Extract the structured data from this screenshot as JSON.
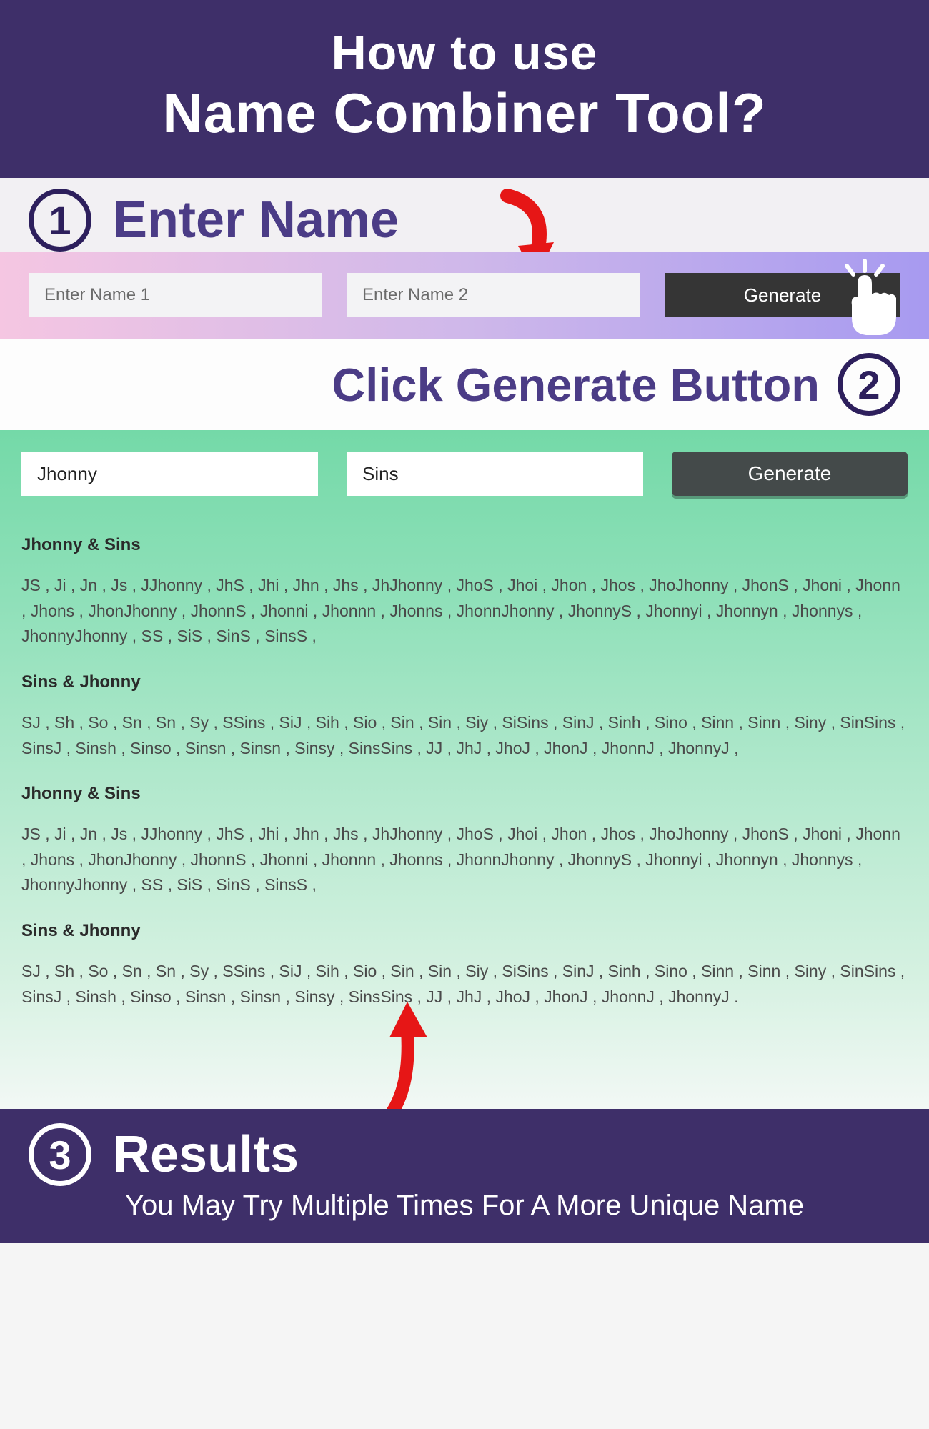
{
  "header": {
    "line1": "How to use",
    "line2": "Name Combiner Tool?"
  },
  "step1": {
    "num": "1",
    "label": "Enter Name",
    "input1_placeholder": "Enter Name 1",
    "input2_placeholder": "Enter Name 2",
    "button": "Generate"
  },
  "step2": {
    "num": "2",
    "label": "Click Generate Button"
  },
  "results": {
    "input1_value": "Jhonny",
    "input2_value": "Sins",
    "button": "Generate",
    "blocks": [
      {
        "heading": "Jhonny & Sins",
        "text": "JS , Ji , Jn , Js , JJhonny , JhS , Jhi , Jhn , Jhs , JhJhonny , JhoS , Jhoi , Jhon , Jhos , JhoJhonny , JhonS , Jhoni , Jhonn , Jhons , JhonJhonny , JhonnS , Jhonni , Jhonnn , Jhonns , JhonnJhonny , JhonnyS , Jhonnyi , Jhonnyn , Jhonnys , JhonnyJhonny , SS , SiS , SinS , SinsS ,"
      },
      {
        "heading": "Sins & Jhonny",
        "text": "SJ , Sh , So , Sn , Sn , Sy , SSins , SiJ , Sih , Sio , Sin , Sin , Siy , SiSins , SinJ , Sinh , Sino , Sinn , Sinn , Siny , SinSins , SinsJ , Sinsh , Sinso , Sinsn , Sinsn , Sinsy , SinsSins , JJ , JhJ , JhoJ , JhonJ , JhonnJ , JhonnyJ ,"
      },
      {
        "heading": "Jhonny & Sins",
        "text": "JS , Ji , Jn , Js , JJhonny , JhS , Jhi , Jhn , Jhs , JhJhonny , JhoS , Jhoi , Jhon , Jhos , JhoJhonny , JhonS , Jhoni , Jhonn , Jhons , JhonJhonny , JhonnS , Jhonni , Jhonnn , Jhonns , JhonnJhonny , JhonnyS , Jhonnyi , Jhonnyn , Jhonnys , JhonnyJhonny , SS , SiS , SinS , SinsS ,"
      },
      {
        "heading": "Sins & Jhonny",
        "text": "SJ , Sh , So , Sn , Sn , Sy , SSins , SiJ , Sih , Sio , Sin , Sin , Siy , SiSins , SinJ , Sinh , Sino , Sinn , Sinn , Siny , SinSins , SinsJ , Sinsh , Sinso , Sinsn , Sinsn , Sinsy , SinsSins , JJ , JhJ , JhoJ , JhonJ , JhonnJ , JhonnyJ ."
      }
    ]
  },
  "step3": {
    "num": "3",
    "label": "Results",
    "sub": "You May Try Multiple Times For A More Unique Name"
  }
}
